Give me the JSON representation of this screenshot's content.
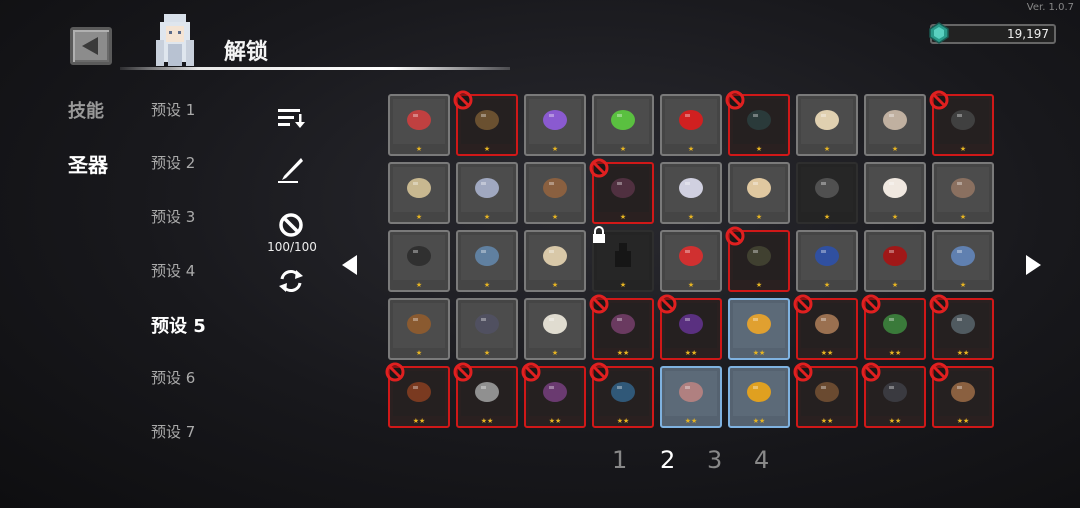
{
  "version": "Ver. 1.0.7",
  "header": {
    "title": "解锁",
    "back_icon": "back-arrow-icon"
  },
  "currency": {
    "icon": "gem-icon",
    "value": "19,197"
  },
  "categories": [
    {
      "label": "技能",
      "active": false
    },
    {
      "label": "圣器",
      "active": true
    }
  ],
  "presets": [
    {
      "label": "预设 1",
      "active": false
    },
    {
      "label": "预设 2",
      "active": false
    },
    {
      "label": "预设 3",
      "active": false
    },
    {
      "label": "预设 4",
      "active": false
    },
    {
      "label": "预设 5",
      "active": true
    },
    {
      "label": "预设 6",
      "active": false
    },
    {
      "label": "预设 7",
      "active": false
    }
  ],
  "tools": {
    "sort_icon": "sort-icon",
    "quill_icon": "quill-icon",
    "ban_icon": "ban-icon",
    "ban_count": "100/100",
    "refresh_icon": "refresh-icon"
  },
  "pagination": {
    "pages": [
      "1",
      "2",
      "3",
      "4"
    ],
    "current": "2"
  },
  "relics": [
    [
      {
        "icon": "crossbow-relic-icon",
        "state": "normal",
        "stars": 1,
        "color": "#c04040"
      },
      {
        "icon": "brown-pouch-relic-icon",
        "state": "banned",
        "stars": 1,
        "color": "#6a5030"
      },
      {
        "icon": "purple-frog-relic-icon",
        "state": "normal",
        "stars": 1,
        "color": "#8a5ad0"
      },
      {
        "icon": "green-slime-relic-icon",
        "state": "normal",
        "stars": 1,
        "color": "#5ac040"
      },
      {
        "icon": "red-gem-relic-icon",
        "state": "normal",
        "stars": 1,
        "color": "#d02020"
      },
      {
        "icon": "dark-gem-relic-icon",
        "state": "banned",
        "stars": 1,
        "color": "#2a3a3a"
      },
      {
        "icon": "fang-relic-icon",
        "state": "normal",
        "stars": 1,
        "color": "#e0d0b0"
      },
      {
        "icon": "tooth-necklace-relic-icon",
        "state": "normal",
        "stars": 1,
        "color": "#c0b0a0"
      },
      {
        "icon": "black-stone-relic-icon",
        "state": "banned",
        "stars": 1,
        "color": "#404040"
      }
    ],
    [
      {
        "icon": "rock-relic-icon",
        "state": "normal",
        "stars": 1,
        "color": "#c8b890"
      },
      {
        "icon": "crystal-shard-relic-icon",
        "state": "normal",
        "stars": 1,
        "color": "#a0a8c0"
      },
      {
        "icon": "open-book-relic-icon",
        "state": "normal",
        "stars": 1,
        "color": "#8a6040"
      },
      {
        "icon": "dark-disc-relic-icon",
        "state": "banned",
        "stars": 1,
        "color": "#503040"
      },
      {
        "icon": "claw-relic-icon",
        "state": "normal",
        "stars": 1,
        "color": "#d0d0e0"
      },
      {
        "icon": "bandage-relic-icon",
        "state": "normal",
        "stars": 1,
        "color": "#e0c8a0"
      },
      {
        "icon": "feather-relic-icon",
        "state": "dark",
        "stars": 1,
        "color": "#505050"
      },
      {
        "icon": "white-fluff-relic-icon",
        "state": "normal",
        "stars": 1,
        "color": "#f0e8e0"
      },
      {
        "icon": "gauntlet-relic-icon",
        "state": "normal",
        "stars": 1,
        "color": "#8a7060"
      }
    ],
    [
      {
        "icon": "frying-pan-relic-icon",
        "state": "normal",
        "stars": 1,
        "color": "#303030"
      },
      {
        "icon": "ring-relic-icon",
        "state": "normal",
        "stars": 1,
        "color": "#6080a0"
      },
      {
        "icon": "scroll-relic-icon",
        "state": "normal",
        "stars": 1,
        "color": "#d8c8a8"
      },
      {
        "icon": "locked-relic-icon",
        "state": "locked",
        "stars": 1,
        "color": "#303030"
      },
      {
        "icon": "magnet-relic-icon",
        "state": "normal",
        "stars": 1,
        "color": "#d03030"
      },
      {
        "icon": "dark-stick-relic-icon",
        "state": "banned",
        "stars": 1,
        "color": "#404030"
      },
      {
        "icon": "shield-relic-icon",
        "state": "normal",
        "stars": 1,
        "color": "#3050a0"
      },
      {
        "icon": "blood-heart-relic-icon",
        "state": "normal",
        "stars": 1,
        "color": "#a01818"
      },
      {
        "icon": "blue-snake-relic-icon",
        "state": "normal",
        "stars": 1,
        "color": "#6080b0"
      }
    ],
    [
      {
        "icon": "acorn-relic-icon",
        "state": "normal",
        "stars": 1,
        "color": "#8a5a30"
      },
      {
        "icon": "potion-bag-relic-icon",
        "state": "normal",
        "stars": 1,
        "color": "#505060"
      },
      {
        "icon": "bone-relic-icon",
        "state": "normal",
        "stars": 1,
        "color": "#e0dcd0"
      },
      {
        "icon": "crystal-cluster-relic-icon",
        "state": "banned",
        "stars": 2,
        "color": "#6a3a60"
      },
      {
        "icon": "purple-cloak-relic-icon",
        "state": "banned",
        "stars": 2,
        "color": "#5a3080"
      },
      {
        "icon": "flask-relic-icon",
        "state": "selected",
        "stars": 2,
        "color": "#e0a030"
      },
      {
        "icon": "fist-relic-icon",
        "state": "banned",
        "stars": 2,
        "color": "#9a7050"
      },
      {
        "icon": "green-tome-relic-icon",
        "state": "banned",
        "stars": 2,
        "color": "#3a7a3a"
      },
      {
        "icon": "iron-mask-relic-icon",
        "state": "banned",
        "stars": 2,
        "color": "#505a60"
      }
    ],
    [
      {
        "icon": "bronze-coin-relic-icon",
        "state": "banned",
        "stars": 2,
        "color": "#7a3a20"
      },
      {
        "icon": "dice-relic-icon",
        "state": "banned",
        "stars": 2,
        "color": "#909090"
      },
      {
        "icon": "purple-book-relic-icon",
        "state": "banned",
        "stars": 2,
        "color": "#6a3a70"
      },
      {
        "icon": "blue-leaves-relic-icon",
        "state": "banned",
        "stars": 2,
        "color": "#305878"
      },
      {
        "icon": "pendant-relic-icon",
        "state": "selected",
        "stars": 2,
        "color": "#b08080"
      },
      {
        "icon": "gold-medal-relic-icon",
        "state": "selected",
        "stars": 2,
        "color": "#e0a020"
      },
      {
        "icon": "dagger-relic-icon",
        "state": "banned",
        "stars": 2,
        "color": "#6a4a30"
      },
      {
        "icon": "dark-pod-relic-icon",
        "state": "banned",
        "stars": 2,
        "color": "#3a3a40"
      },
      {
        "icon": "antler-relic-icon",
        "state": "banned",
        "stars": 2,
        "color": "#8a6040"
      }
    ]
  ]
}
